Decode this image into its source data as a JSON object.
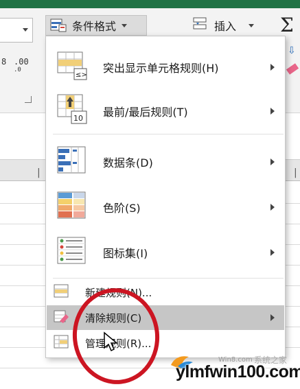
{
  "ribbon": {
    "conditional_format_label": "条件格式",
    "insert_label": "插入",
    "autosum_symbol": "Σ",
    "decimal_increase": ".00",
    "decimal_decrease_top": "8",
    "decimal_small": ".0"
  },
  "menu": {
    "items": [
      {
        "label": "突出显示单元格规则(H)",
        "icon": "highlight-cells-rules-icon"
      },
      {
        "label": "最前/最后规则(T)",
        "icon": "top-bottom-rules-icon",
        "icon_text": "10"
      },
      {
        "label": "数据条(D)",
        "icon": "data-bars-icon"
      },
      {
        "label": "色阶(S)",
        "icon": "color-scales-icon"
      },
      {
        "label": "图标集(I)",
        "icon": "icon-sets-icon"
      },
      {
        "label": "新建规则(N)...",
        "icon": "new-rule-icon"
      },
      {
        "label": "清除规则(C)",
        "icon": "clear-rules-icon"
      },
      {
        "label": "管理规则(R)...",
        "icon": "manage-rules-icon"
      }
    ]
  },
  "watermark": {
    "text": "ylmfwin100.com",
    "small": "Win8.com",
    "cn": "系统之家"
  },
  "colors": {
    "title_bar": "#217346",
    "annotation": "#cc1522",
    "highlight_row": "#c6c6c6"
  }
}
